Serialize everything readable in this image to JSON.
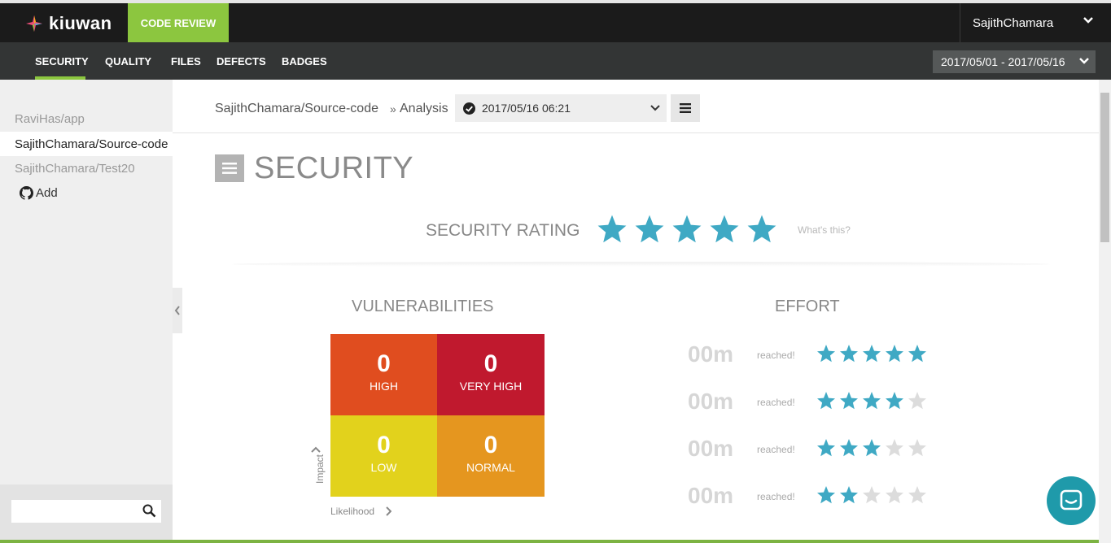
{
  "app": {
    "logo_text": "kiuwan",
    "module": "CODE REVIEW",
    "user": "SajithChamara"
  },
  "nav": {
    "items": [
      "SECURITY",
      "QUALITY",
      "FILES",
      "DEFECTS",
      "BADGES"
    ],
    "active": "SECURITY",
    "date_range": "2017/05/01 - 2017/05/16"
  },
  "sidebar": {
    "items": [
      {
        "label": "RaviHas/app",
        "active": false
      },
      {
        "label": "SajithChamara/Source-code",
        "active": true
      },
      {
        "label": "SajithChamara/Test20",
        "active": false
      }
    ],
    "add_label": "Add",
    "search_placeholder": ""
  },
  "breadcrumb": {
    "app": "SajithChamara/Source-code",
    "separator": "»",
    "section": "Analysis",
    "analysis_date": "2017/05/16 06:21"
  },
  "page": {
    "title": "SECURITY"
  },
  "rating": {
    "label": "SECURITY RATING",
    "stars": 5,
    "max_stars": 5,
    "help": "What's this?"
  },
  "vulnerabilities": {
    "title": "VULNERABILITIES",
    "cells": [
      {
        "value": "0",
        "label": "HIGH",
        "color": "#e04d1f"
      },
      {
        "value": "0",
        "label": "VERY HIGH",
        "color": "#c0192e"
      },
      {
        "value": "0",
        "label": "LOW",
        "color": "#e2d21c"
      },
      {
        "value": "0",
        "label": "NORMAL",
        "color": "#e5961f"
      }
    ],
    "y_axis": "Impact",
    "x_axis": "Likelihood"
  },
  "effort": {
    "title": "EFFORT",
    "rows": [
      {
        "value": "00m",
        "status": "reached!",
        "stars": 5
      },
      {
        "value": "00m",
        "status": "reached!",
        "stars": 4
      },
      {
        "value": "00m",
        "status": "reached!",
        "stars": 3
      },
      {
        "value": "00m",
        "status": "reached!",
        "stars": 2
      }
    ]
  },
  "colors": {
    "accent": "#8cc63f",
    "star": "#3fa9c4",
    "star_empty": "#dcdcdc",
    "chat": "#1f9aaa"
  },
  "icons": [
    "kiuwan-logo-icon",
    "chevron-down-icon",
    "github-icon",
    "search-icon",
    "chevron-left-icon",
    "check-circle-icon",
    "hamburger-icon",
    "star-icon",
    "chevron-up-icon",
    "chevron-right-icon",
    "chat-icon"
  ]
}
